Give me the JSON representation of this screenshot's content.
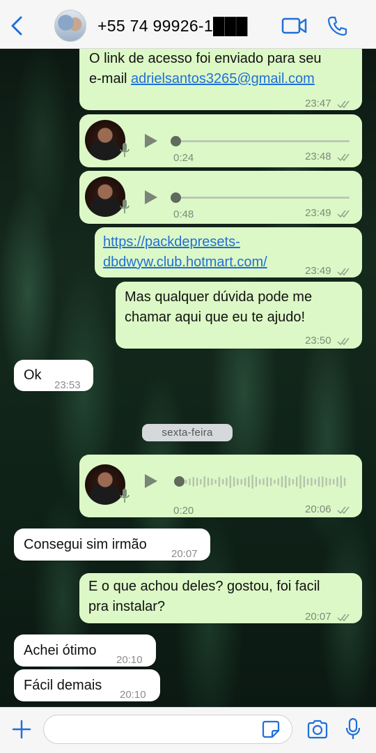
{
  "header": {
    "contact_name": "+55 74 99926-1███",
    "back_icon": "chevron-left-icon",
    "video_icon": "video-camera-icon",
    "call_icon": "phone-icon"
  },
  "messages": [
    {
      "type": "text",
      "dir": "out",
      "line1": "O link de acesso foi enviado para seu",
      "prefix": "e-mail ",
      "link": "adrielsantos3265@gmail.com",
      "time": "23:47"
    },
    {
      "type": "voice",
      "dir": "out",
      "duration": "0:24",
      "time": "23:48"
    },
    {
      "type": "voice",
      "dir": "out",
      "duration": "0:48",
      "time": "23:49"
    },
    {
      "type": "link",
      "dir": "out",
      "line1": "https://packdepresets-",
      "line2": "dbdwyw.club.hotmart.com/",
      "time": "23:49"
    },
    {
      "type": "text",
      "dir": "out",
      "line1": "Mas qualquer dúvida pode me",
      "line2": "chamar aqui que eu te ajudo!",
      "time": "23:50"
    },
    {
      "type": "text",
      "dir": "in",
      "text": "Ok",
      "time": "23:53"
    },
    {
      "type": "voice",
      "dir": "out",
      "duration": "0:20",
      "time": "20:06"
    },
    {
      "type": "text",
      "dir": "in",
      "text": "Consegui sim irmão",
      "time": "20:07"
    },
    {
      "type": "text",
      "dir": "out",
      "line1": "E o que achou deles? gostou, foi facil",
      "line2": "pra instalar?",
      "time": "20:07"
    },
    {
      "type": "text",
      "dir": "in",
      "text": "Achei ótimo",
      "time": "20:10"
    },
    {
      "type": "text",
      "dir": "in",
      "text": "Fácil demais",
      "time": "20:10"
    }
  ],
  "day_separator": "sexta-feira",
  "input": {
    "placeholder": "",
    "plus_icon": "plus-icon",
    "sticker_icon": "sticker-icon",
    "camera_icon": "camera-icon",
    "mic_icon": "microphone-icon"
  },
  "colors": {
    "outgoing_bubble": "#dcf8c6",
    "incoming_bubble": "#ffffff",
    "accent": "#1f6fd8"
  }
}
